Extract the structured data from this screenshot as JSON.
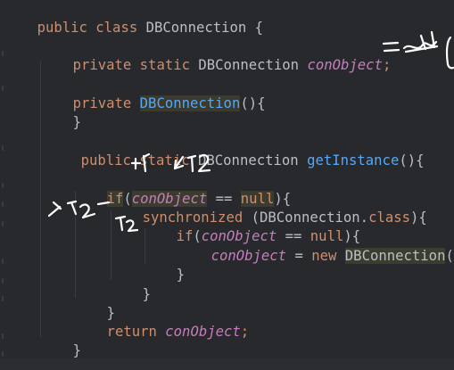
{
  "code": {
    "l1": {
      "kw": "public class ",
      "name": "DBConnection",
      "rest": " {"
    },
    "l2": {
      "kw": "private static ",
      "type": "DBConnection ",
      "field": "conObject",
      "semi": ";"
    },
    "l3": {
      "kw": "private ",
      "ctor": "DBConnection",
      "rest": "(){"
    },
    "l4": {
      "rest": "}"
    },
    "l5": {
      "kw": "public static ",
      "type": "DBConnection ",
      "method": "getInstance",
      "rest": "(){"
    },
    "l6": {
      "kw": "if",
      "open": "(",
      "field": "conObject",
      "op": " == ",
      "null": "null",
      "rest": "){"
    },
    "l7": {
      "kw": "synchronized",
      "rest": " (DBConnection.",
      "cls": "class",
      "end": "){"
    },
    "l8": {
      "kw": "if",
      "open": "(",
      "field": "conObject",
      "op": " == ",
      "null": "null",
      "rest": "){"
    },
    "l9": {
      "field": "conObject",
      "op": " = ",
      "kw": "new",
      "ctor": "DBConnection",
      "rest": "();"
    },
    "l10": {
      "rest": "}"
    },
    "l11": {
      "rest": "}"
    },
    "l12": {
      "rest": "}"
    },
    "l13": {
      "kw": "return ",
      "field": "conObject",
      "semi": ";"
    },
    "l14": {
      "rest": "}"
    },
    "l15": {
      "rest": "}"
    }
  },
  "annotations": {
    "ink_color": "#ffffff",
    "note_top_left": "+1",
    "note_top_right": "← T2",
    "note_side": "T1 T2",
    "note_below": "T2"
  }
}
